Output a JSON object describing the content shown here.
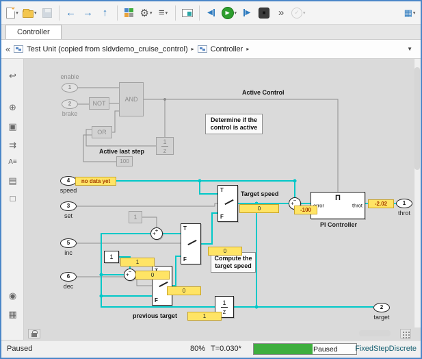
{
  "colors": {
    "window-border": "#4a86c8",
    "canvas-bg": "#dadada",
    "highlight": "#00c8c8",
    "wire": "#8f8f8f",
    "badge-bg": "#ffe465",
    "badge-border": "#c8a42a",
    "stale-text": "#a33b00",
    "run-green": "#2e9e2e",
    "progress-green": "#3fae3f",
    "solver-text": "#135e70",
    "accent-blue": "#2e7bbf"
  },
  "tabbar": {
    "tab": "Controller"
  },
  "breadcrumb": {
    "collapse": "«",
    "root": "Test Unit (copied from sldvdemo_cruise_control)",
    "current": "Controller",
    "sep": "▸",
    "dropdown": "▼"
  },
  "toolbar": {
    "caret": "▾",
    "back": "←",
    "forward": "→",
    "up": "↑",
    "gear": "⚙",
    "list": "≡",
    "run": "▶",
    "step_back": "◀",
    "step_fwd": "▶",
    "stop": "■",
    "overflow": "»",
    "check": "✓",
    "grid": "▦"
  },
  "palette": {
    "icons": [
      {
        "name": "nav-back",
        "glyph": "↩"
      },
      {
        "name": "zoom-in",
        "glyph": "⊕"
      },
      {
        "name": "fit-to-view",
        "glyph": "▣"
      },
      {
        "name": "double-arrow",
        "glyph": "⇉"
      },
      {
        "name": "annotation",
        "glyph": "A≡"
      },
      {
        "name": "image",
        "glyph": "▤"
      },
      {
        "name": "area",
        "glyph": "□"
      },
      {
        "name": "camera",
        "glyph": "◉"
      },
      {
        "name": "viewmarks",
        "glyph": "▦"
      }
    ]
  },
  "diagram": {
    "inports": [
      {
        "num": "1",
        "label": "enable"
      },
      {
        "num": "2",
        "label": "brake"
      },
      {
        "num": "4",
        "label": "speed"
      },
      {
        "num": "3",
        "label": "set"
      },
      {
        "num": "5",
        "label": "inc"
      },
      {
        "num": "6",
        "label": "dec"
      }
    ],
    "outports": [
      {
        "num": "1",
        "label": "throt"
      },
      {
        "num": "2",
        "label": "target"
      }
    ],
    "blocks": {
      "not": "NOT",
      "and": "AND",
      "or": "OR",
      "const100": "100",
      "const_inc": "1",
      "const_dec": "1",
      "delay_num": "1",
      "delay_den": "z",
      "switch_t": "T",
      "switch_f": "F",
      "pi_symbol": "Π",
      "pi_in": "error",
      "pi_out": "throt",
      "pi_label": "PI Controller"
    },
    "sums": {
      "s1_l": "+",
      "s1_t": "−",
      "s2_l": "+",
      "s2_t": "+",
      "s3_l": "+",
      "s3_t": "−"
    },
    "annotations": {
      "active_control": "Active Control",
      "determine": "Determine if the control is active",
      "active_last_step": "Active last step",
      "target_speed": "Target speed",
      "compute": "Compute the target speed",
      "previous_target": "previous target"
    },
    "badges": {
      "speed": "no data yet",
      "target": "0",
      "pi_in": "-100",
      "pi_out": "-2.02",
      "inc1": "1",
      "sum_dec": "0",
      "switch_dec": "0",
      "switch_inc": "0",
      "prev": "1"
    }
  },
  "statusbar": {
    "state": "Paused",
    "zoom": "80%",
    "time": "T=0.030*",
    "progress_label": "Paused",
    "progress_percent": 57,
    "solver": "FixedStepDiscrete"
  }
}
